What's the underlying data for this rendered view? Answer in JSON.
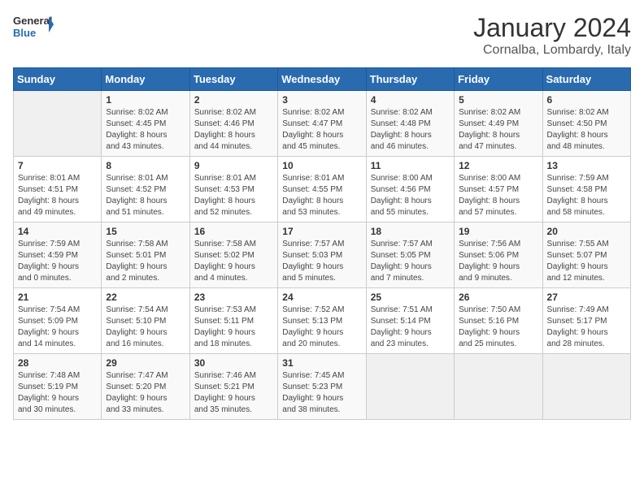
{
  "header": {
    "logo_general": "General",
    "logo_blue": "Blue",
    "month_year": "January 2024",
    "location": "Cornalba, Lombardy, Italy"
  },
  "days_of_week": [
    "Sunday",
    "Monday",
    "Tuesday",
    "Wednesday",
    "Thursday",
    "Friday",
    "Saturday"
  ],
  "weeks": [
    [
      {
        "day": "",
        "info": ""
      },
      {
        "day": "1",
        "info": "Sunrise: 8:02 AM\nSunset: 4:45 PM\nDaylight: 8 hours\nand 43 minutes."
      },
      {
        "day": "2",
        "info": "Sunrise: 8:02 AM\nSunset: 4:46 PM\nDaylight: 8 hours\nand 44 minutes."
      },
      {
        "day": "3",
        "info": "Sunrise: 8:02 AM\nSunset: 4:47 PM\nDaylight: 8 hours\nand 45 minutes."
      },
      {
        "day": "4",
        "info": "Sunrise: 8:02 AM\nSunset: 4:48 PM\nDaylight: 8 hours\nand 46 minutes."
      },
      {
        "day": "5",
        "info": "Sunrise: 8:02 AM\nSunset: 4:49 PM\nDaylight: 8 hours\nand 47 minutes."
      },
      {
        "day": "6",
        "info": "Sunrise: 8:02 AM\nSunset: 4:50 PM\nDaylight: 8 hours\nand 48 minutes."
      }
    ],
    [
      {
        "day": "7",
        "info": "Sunrise: 8:01 AM\nSunset: 4:51 PM\nDaylight: 8 hours\nand 49 minutes."
      },
      {
        "day": "8",
        "info": "Sunrise: 8:01 AM\nSunset: 4:52 PM\nDaylight: 8 hours\nand 51 minutes."
      },
      {
        "day": "9",
        "info": "Sunrise: 8:01 AM\nSunset: 4:53 PM\nDaylight: 8 hours\nand 52 minutes."
      },
      {
        "day": "10",
        "info": "Sunrise: 8:01 AM\nSunset: 4:55 PM\nDaylight: 8 hours\nand 53 minutes."
      },
      {
        "day": "11",
        "info": "Sunrise: 8:00 AM\nSunset: 4:56 PM\nDaylight: 8 hours\nand 55 minutes."
      },
      {
        "day": "12",
        "info": "Sunrise: 8:00 AM\nSunset: 4:57 PM\nDaylight: 8 hours\nand 57 minutes."
      },
      {
        "day": "13",
        "info": "Sunrise: 7:59 AM\nSunset: 4:58 PM\nDaylight: 8 hours\nand 58 minutes."
      }
    ],
    [
      {
        "day": "14",
        "info": "Sunrise: 7:59 AM\nSunset: 4:59 PM\nDaylight: 9 hours\nand 0 minutes."
      },
      {
        "day": "15",
        "info": "Sunrise: 7:58 AM\nSunset: 5:01 PM\nDaylight: 9 hours\nand 2 minutes."
      },
      {
        "day": "16",
        "info": "Sunrise: 7:58 AM\nSunset: 5:02 PM\nDaylight: 9 hours\nand 4 minutes."
      },
      {
        "day": "17",
        "info": "Sunrise: 7:57 AM\nSunset: 5:03 PM\nDaylight: 9 hours\nand 5 minutes."
      },
      {
        "day": "18",
        "info": "Sunrise: 7:57 AM\nSunset: 5:05 PM\nDaylight: 9 hours\nand 7 minutes."
      },
      {
        "day": "19",
        "info": "Sunrise: 7:56 AM\nSunset: 5:06 PM\nDaylight: 9 hours\nand 9 minutes."
      },
      {
        "day": "20",
        "info": "Sunrise: 7:55 AM\nSunset: 5:07 PM\nDaylight: 9 hours\nand 12 minutes."
      }
    ],
    [
      {
        "day": "21",
        "info": "Sunrise: 7:54 AM\nSunset: 5:09 PM\nDaylight: 9 hours\nand 14 minutes."
      },
      {
        "day": "22",
        "info": "Sunrise: 7:54 AM\nSunset: 5:10 PM\nDaylight: 9 hours\nand 16 minutes."
      },
      {
        "day": "23",
        "info": "Sunrise: 7:53 AM\nSunset: 5:11 PM\nDaylight: 9 hours\nand 18 minutes."
      },
      {
        "day": "24",
        "info": "Sunrise: 7:52 AM\nSunset: 5:13 PM\nDaylight: 9 hours\nand 20 minutes."
      },
      {
        "day": "25",
        "info": "Sunrise: 7:51 AM\nSunset: 5:14 PM\nDaylight: 9 hours\nand 23 minutes."
      },
      {
        "day": "26",
        "info": "Sunrise: 7:50 AM\nSunset: 5:16 PM\nDaylight: 9 hours\nand 25 minutes."
      },
      {
        "day": "27",
        "info": "Sunrise: 7:49 AM\nSunset: 5:17 PM\nDaylight: 9 hours\nand 28 minutes."
      }
    ],
    [
      {
        "day": "28",
        "info": "Sunrise: 7:48 AM\nSunset: 5:19 PM\nDaylight: 9 hours\nand 30 minutes."
      },
      {
        "day": "29",
        "info": "Sunrise: 7:47 AM\nSunset: 5:20 PM\nDaylight: 9 hours\nand 33 minutes."
      },
      {
        "day": "30",
        "info": "Sunrise: 7:46 AM\nSunset: 5:21 PM\nDaylight: 9 hours\nand 35 minutes."
      },
      {
        "day": "31",
        "info": "Sunrise: 7:45 AM\nSunset: 5:23 PM\nDaylight: 9 hours\nand 38 minutes."
      },
      {
        "day": "",
        "info": ""
      },
      {
        "day": "",
        "info": ""
      },
      {
        "day": "",
        "info": ""
      }
    ]
  ]
}
